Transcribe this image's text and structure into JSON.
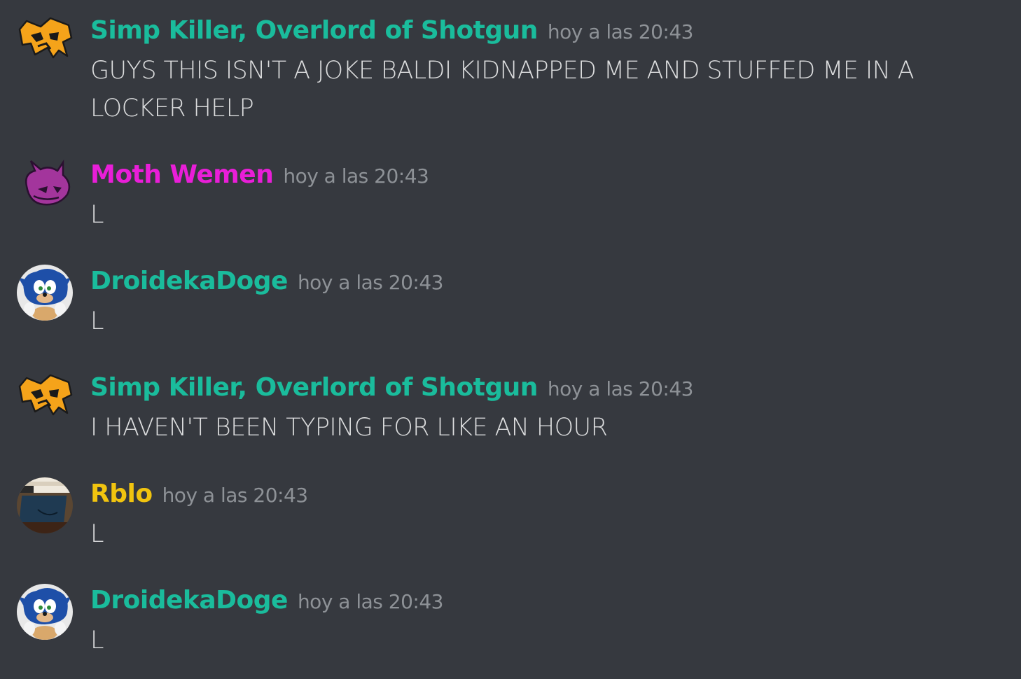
{
  "colors": {
    "background": "#36393f",
    "timestamp": "#8e9297",
    "message_text": "#dcddde",
    "teal_role": "#1abc9c",
    "magenta_role": "#e91ed8",
    "yellow_role": "#f1c40f"
  },
  "messages": [
    {
      "author": "Simp Killer, Overlord of Shotgun",
      "author_color": "#1abc9c",
      "avatar_icon": "orange-fox-emblem-icon",
      "timestamp": "hoy a las 20:43",
      "text": "GUYS THIS ISN'T A JOKE BALDI KIDNAPPED ME AND STUFFED ME IN A LOCKER HELP"
    },
    {
      "author": "Moth Wemen",
      "author_color": "#e91ed8",
      "avatar_icon": "purple-creature-icon",
      "timestamp": "hoy a las 20:43",
      "text": "L"
    },
    {
      "author": "DroidekaDoge",
      "author_color": "#1abc9c",
      "avatar_icon": "sonic-plush-icon",
      "timestamp": "hoy a las 20:43",
      "text": "L"
    },
    {
      "author": "Simp Killer, Overlord of Shotgun",
      "author_color": "#1abc9c",
      "avatar_icon": "orange-fox-emblem-icon",
      "timestamp": "hoy a las 20:43",
      "text": "I HAVEN'T BEEN TYPING FOR LIKE AN HOUR"
    },
    {
      "author": "Rblo",
      "author_color": "#f1c40f",
      "avatar_icon": "game-screenshot-icon",
      "timestamp": "hoy a las 20:43",
      "text": "L"
    },
    {
      "author": "DroidekaDoge",
      "author_color": "#1abc9c",
      "avatar_icon": "sonic-plush-icon",
      "timestamp": "hoy a las 20:43",
      "text": "L"
    }
  ]
}
